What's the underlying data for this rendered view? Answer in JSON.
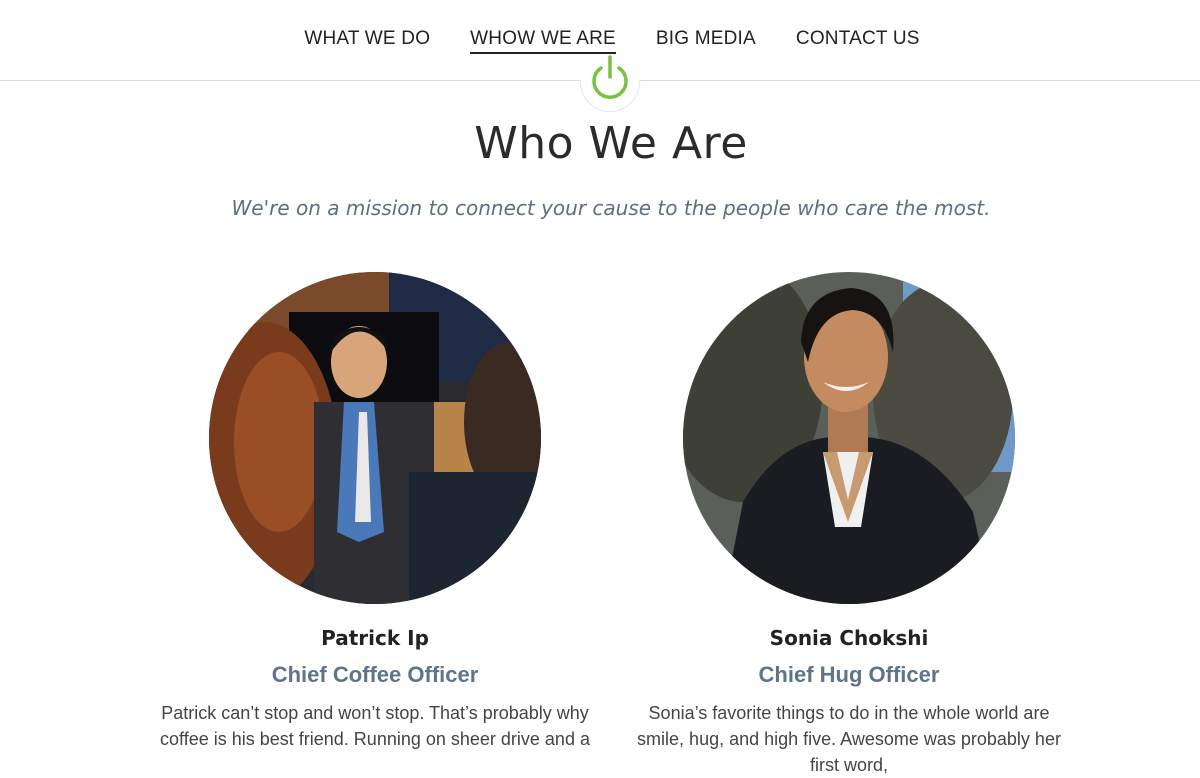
{
  "nav": {
    "items": [
      {
        "label": "WHAT WE DO",
        "active": false
      },
      {
        "label": "WHOW WE ARE",
        "active": true
      },
      {
        "label": "BIG MEDIA",
        "active": false
      },
      {
        "label": "CONTACT US",
        "active": false
      }
    ],
    "logo_icon": "power-icon",
    "logo_color": "#7ac142"
  },
  "page": {
    "title": "Who We Are",
    "tagline": "We're on a mission to connect your cause to the people who care the most."
  },
  "team": [
    {
      "name": "Patrick Ip",
      "role": "Chief Coffee Officer",
      "bio": "Patrick can’t stop and won’t stop. That’s probably why coffee is his best friend. Running on sheer drive and a"
    },
    {
      "name": "Sonia Chokshi",
      "role": "Chief Hug Officer",
      "bio": "Sonia’s favorite things to do in the whole world are smile, hug, and high five. Awesome was probably her first word,"
    }
  ],
  "colors": {
    "accent_green": "#7ac142",
    "role_text": "#5f738a",
    "tagline_text": "#5e6e80"
  }
}
